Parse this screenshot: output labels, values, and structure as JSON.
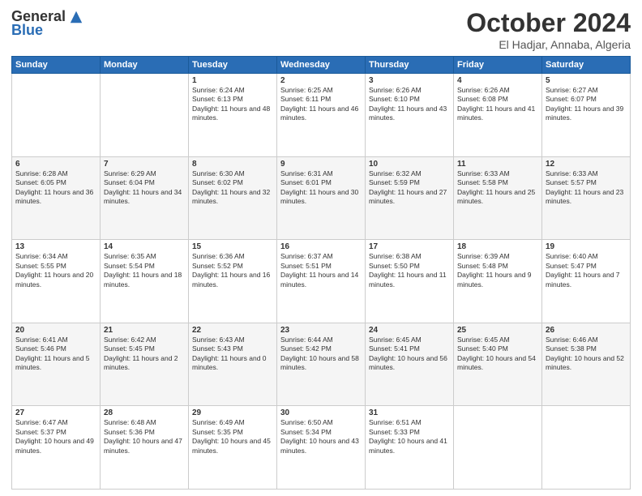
{
  "logo": {
    "general": "General",
    "blue": "Blue"
  },
  "header": {
    "month": "October 2024",
    "location": "El Hadjar, Annaba, Algeria"
  },
  "weekdays": [
    "Sunday",
    "Monday",
    "Tuesday",
    "Wednesday",
    "Thursday",
    "Friday",
    "Saturday"
  ],
  "weeks": [
    [
      {
        "day": "",
        "sunrise": "",
        "sunset": "",
        "daylight": ""
      },
      {
        "day": "",
        "sunrise": "",
        "sunset": "",
        "daylight": ""
      },
      {
        "day": "1",
        "sunrise": "Sunrise: 6:24 AM",
        "sunset": "Sunset: 6:13 PM",
        "daylight": "Daylight: 11 hours and 48 minutes."
      },
      {
        "day": "2",
        "sunrise": "Sunrise: 6:25 AM",
        "sunset": "Sunset: 6:11 PM",
        "daylight": "Daylight: 11 hours and 46 minutes."
      },
      {
        "day": "3",
        "sunrise": "Sunrise: 6:26 AM",
        "sunset": "Sunset: 6:10 PM",
        "daylight": "Daylight: 11 hours and 43 minutes."
      },
      {
        "day": "4",
        "sunrise": "Sunrise: 6:26 AM",
        "sunset": "Sunset: 6:08 PM",
        "daylight": "Daylight: 11 hours and 41 minutes."
      },
      {
        "day": "5",
        "sunrise": "Sunrise: 6:27 AM",
        "sunset": "Sunset: 6:07 PM",
        "daylight": "Daylight: 11 hours and 39 minutes."
      }
    ],
    [
      {
        "day": "6",
        "sunrise": "Sunrise: 6:28 AM",
        "sunset": "Sunset: 6:05 PM",
        "daylight": "Daylight: 11 hours and 36 minutes."
      },
      {
        "day": "7",
        "sunrise": "Sunrise: 6:29 AM",
        "sunset": "Sunset: 6:04 PM",
        "daylight": "Daylight: 11 hours and 34 minutes."
      },
      {
        "day": "8",
        "sunrise": "Sunrise: 6:30 AM",
        "sunset": "Sunset: 6:02 PM",
        "daylight": "Daylight: 11 hours and 32 minutes."
      },
      {
        "day": "9",
        "sunrise": "Sunrise: 6:31 AM",
        "sunset": "Sunset: 6:01 PM",
        "daylight": "Daylight: 11 hours and 30 minutes."
      },
      {
        "day": "10",
        "sunrise": "Sunrise: 6:32 AM",
        "sunset": "Sunset: 5:59 PM",
        "daylight": "Daylight: 11 hours and 27 minutes."
      },
      {
        "day": "11",
        "sunrise": "Sunrise: 6:33 AM",
        "sunset": "Sunset: 5:58 PM",
        "daylight": "Daylight: 11 hours and 25 minutes."
      },
      {
        "day": "12",
        "sunrise": "Sunrise: 6:33 AM",
        "sunset": "Sunset: 5:57 PM",
        "daylight": "Daylight: 11 hours and 23 minutes."
      }
    ],
    [
      {
        "day": "13",
        "sunrise": "Sunrise: 6:34 AM",
        "sunset": "Sunset: 5:55 PM",
        "daylight": "Daylight: 11 hours and 20 minutes."
      },
      {
        "day": "14",
        "sunrise": "Sunrise: 6:35 AM",
        "sunset": "Sunset: 5:54 PM",
        "daylight": "Daylight: 11 hours and 18 minutes."
      },
      {
        "day": "15",
        "sunrise": "Sunrise: 6:36 AM",
        "sunset": "Sunset: 5:52 PM",
        "daylight": "Daylight: 11 hours and 16 minutes."
      },
      {
        "day": "16",
        "sunrise": "Sunrise: 6:37 AM",
        "sunset": "Sunset: 5:51 PM",
        "daylight": "Daylight: 11 hours and 14 minutes."
      },
      {
        "day": "17",
        "sunrise": "Sunrise: 6:38 AM",
        "sunset": "Sunset: 5:50 PM",
        "daylight": "Daylight: 11 hours and 11 minutes."
      },
      {
        "day": "18",
        "sunrise": "Sunrise: 6:39 AM",
        "sunset": "Sunset: 5:48 PM",
        "daylight": "Daylight: 11 hours and 9 minutes."
      },
      {
        "day": "19",
        "sunrise": "Sunrise: 6:40 AM",
        "sunset": "Sunset: 5:47 PM",
        "daylight": "Daylight: 11 hours and 7 minutes."
      }
    ],
    [
      {
        "day": "20",
        "sunrise": "Sunrise: 6:41 AM",
        "sunset": "Sunset: 5:46 PM",
        "daylight": "Daylight: 11 hours and 5 minutes."
      },
      {
        "day": "21",
        "sunrise": "Sunrise: 6:42 AM",
        "sunset": "Sunset: 5:45 PM",
        "daylight": "Daylight: 11 hours and 2 minutes."
      },
      {
        "day": "22",
        "sunrise": "Sunrise: 6:43 AM",
        "sunset": "Sunset: 5:43 PM",
        "daylight": "Daylight: 11 hours and 0 minutes."
      },
      {
        "day": "23",
        "sunrise": "Sunrise: 6:44 AM",
        "sunset": "Sunset: 5:42 PM",
        "daylight": "Daylight: 10 hours and 58 minutes."
      },
      {
        "day": "24",
        "sunrise": "Sunrise: 6:45 AM",
        "sunset": "Sunset: 5:41 PM",
        "daylight": "Daylight: 10 hours and 56 minutes."
      },
      {
        "day": "25",
        "sunrise": "Sunrise: 6:45 AM",
        "sunset": "Sunset: 5:40 PM",
        "daylight": "Daylight: 10 hours and 54 minutes."
      },
      {
        "day": "26",
        "sunrise": "Sunrise: 6:46 AM",
        "sunset": "Sunset: 5:38 PM",
        "daylight": "Daylight: 10 hours and 52 minutes."
      }
    ],
    [
      {
        "day": "27",
        "sunrise": "Sunrise: 6:47 AM",
        "sunset": "Sunset: 5:37 PM",
        "daylight": "Daylight: 10 hours and 49 minutes."
      },
      {
        "day": "28",
        "sunrise": "Sunrise: 6:48 AM",
        "sunset": "Sunset: 5:36 PM",
        "daylight": "Daylight: 10 hours and 47 minutes."
      },
      {
        "day": "29",
        "sunrise": "Sunrise: 6:49 AM",
        "sunset": "Sunset: 5:35 PM",
        "daylight": "Daylight: 10 hours and 45 minutes."
      },
      {
        "day": "30",
        "sunrise": "Sunrise: 6:50 AM",
        "sunset": "Sunset: 5:34 PM",
        "daylight": "Daylight: 10 hours and 43 minutes."
      },
      {
        "day": "31",
        "sunrise": "Sunrise: 6:51 AM",
        "sunset": "Sunset: 5:33 PM",
        "daylight": "Daylight: 10 hours and 41 minutes."
      },
      {
        "day": "",
        "sunrise": "",
        "sunset": "",
        "daylight": ""
      },
      {
        "day": "",
        "sunrise": "",
        "sunset": "",
        "daylight": ""
      }
    ]
  ]
}
